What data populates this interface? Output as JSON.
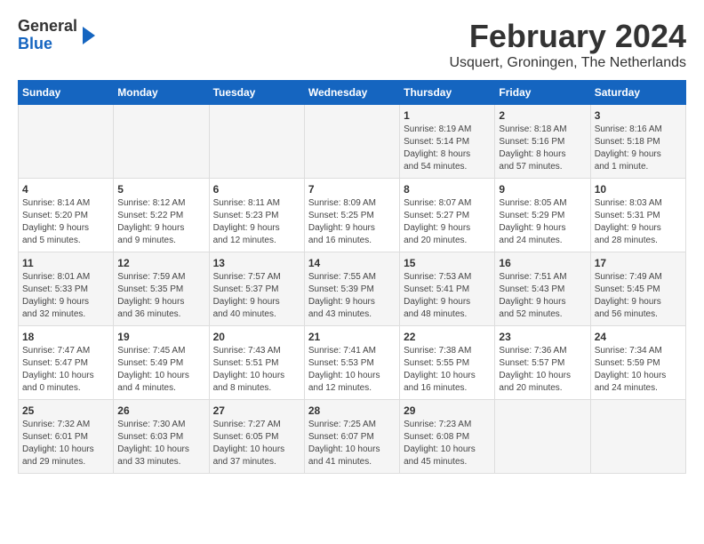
{
  "logo": {
    "general": "General",
    "blue": "Blue"
  },
  "title": "February 2024",
  "subtitle": "Usquert, Groningen, The Netherlands",
  "days_of_week": [
    "Sunday",
    "Monday",
    "Tuesday",
    "Wednesday",
    "Thursday",
    "Friday",
    "Saturday"
  ],
  "weeks": [
    [
      {
        "day": "",
        "info": ""
      },
      {
        "day": "",
        "info": ""
      },
      {
        "day": "",
        "info": ""
      },
      {
        "day": "",
        "info": ""
      },
      {
        "day": "1",
        "info": "Sunrise: 8:19 AM\nSunset: 5:14 PM\nDaylight: 8 hours\nand 54 minutes."
      },
      {
        "day": "2",
        "info": "Sunrise: 8:18 AM\nSunset: 5:16 PM\nDaylight: 8 hours\nand 57 minutes."
      },
      {
        "day": "3",
        "info": "Sunrise: 8:16 AM\nSunset: 5:18 PM\nDaylight: 9 hours\nand 1 minute."
      }
    ],
    [
      {
        "day": "4",
        "info": "Sunrise: 8:14 AM\nSunset: 5:20 PM\nDaylight: 9 hours\nand 5 minutes."
      },
      {
        "day": "5",
        "info": "Sunrise: 8:12 AM\nSunset: 5:22 PM\nDaylight: 9 hours\nand 9 minutes."
      },
      {
        "day": "6",
        "info": "Sunrise: 8:11 AM\nSunset: 5:23 PM\nDaylight: 9 hours\nand 12 minutes."
      },
      {
        "day": "7",
        "info": "Sunrise: 8:09 AM\nSunset: 5:25 PM\nDaylight: 9 hours\nand 16 minutes."
      },
      {
        "day": "8",
        "info": "Sunrise: 8:07 AM\nSunset: 5:27 PM\nDaylight: 9 hours\nand 20 minutes."
      },
      {
        "day": "9",
        "info": "Sunrise: 8:05 AM\nSunset: 5:29 PM\nDaylight: 9 hours\nand 24 minutes."
      },
      {
        "day": "10",
        "info": "Sunrise: 8:03 AM\nSunset: 5:31 PM\nDaylight: 9 hours\nand 28 minutes."
      }
    ],
    [
      {
        "day": "11",
        "info": "Sunrise: 8:01 AM\nSunset: 5:33 PM\nDaylight: 9 hours\nand 32 minutes."
      },
      {
        "day": "12",
        "info": "Sunrise: 7:59 AM\nSunset: 5:35 PM\nDaylight: 9 hours\nand 36 minutes."
      },
      {
        "day": "13",
        "info": "Sunrise: 7:57 AM\nSunset: 5:37 PM\nDaylight: 9 hours\nand 40 minutes."
      },
      {
        "day": "14",
        "info": "Sunrise: 7:55 AM\nSunset: 5:39 PM\nDaylight: 9 hours\nand 43 minutes."
      },
      {
        "day": "15",
        "info": "Sunrise: 7:53 AM\nSunset: 5:41 PM\nDaylight: 9 hours\nand 48 minutes."
      },
      {
        "day": "16",
        "info": "Sunrise: 7:51 AM\nSunset: 5:43 PM\nDaylight: 9 hours\nand 52 minutes."
      },
      {
        "day": "17",
        "info": "Sunrise: 7:49 AM\nSunset: 5:45 PM\nDaylight: 9 hours\nand 56 minutes."
      }
    ],
    [
      {
        "day": "18",
        "info": "Sunrise: 7:47 AM\nSunset: 5:47 PM\nDaylight: 10 hours\nand 0 minutes."
      },
      {
        "day": "19",
        "info": "Sunrise: 7:45 AM\nSunset: 5:49 PM\nDaylight: 10 hours\nand 4 minutes."
      },
      {
        "day": "20",
        "info": "Sunrise: 7:43 AM\nSunset: 5:51 PM\nDaylight: 10 hours\nand 8 minutes."
      },
      {
        "day": "21",
        "info": "Sunrise: 7:41 AM\nSunset: 5:53 PM\nDaylight: 10 hours\nand 12 minutes."
      },
      {
        "day": "22",
        "info": "Sunrise: 7:38 AM\nSunset: 5:55 PM\nDaylight: 10 hours\nand 16 minutes."
      },
      {
        "day": "23",
        "info": "Sunrise: 7:36 AM\nSunset: 5:57 PM\nDaylight: 10 hours\nand 20 minutes."
      },
      {
        "day": "24",
        "info": "Sunrise: 7:34 AM\nSunset: 5:59 PM\nDaylight: 10 hours\nand 24 minutes."
      }
    ],
    [
      {
        "day": "25",
        "info": "Sunrise: 7:32 AM\nSunset: 6:01 PM\nDaylight: 10 hours\nand 29 minutes."
      },
      {
        "day": "26",
        "info": "Sunrise: 7:30 AM\nSunset: 6:03 PM\nDaylight: 10 hours\nand 33 minutes."
      },
      {
        "day": "27",
        "info": "Sunrise: 7:27 AM\nSunset: 6:05 PM\nDaylight: 10 hours\nand 37 minutes."
      },
      {
        "day": "28",
        "info": "Sunrise: 7:25 AM\nSunset: 6:07 PM\nDaylight: 10 hours\nand 41 minutes."
      },
      {
        "day": "29",
        "info": "Sunrise: 7:23 AM\nSunset: 6:08 PM\nDaylight: 10 hours\nand 45 minutes."
      },
      {
        "day": "",
        "info": ""
      },
      {
        "day": "",
        "info": ""
      }
    ]
  ]
}
